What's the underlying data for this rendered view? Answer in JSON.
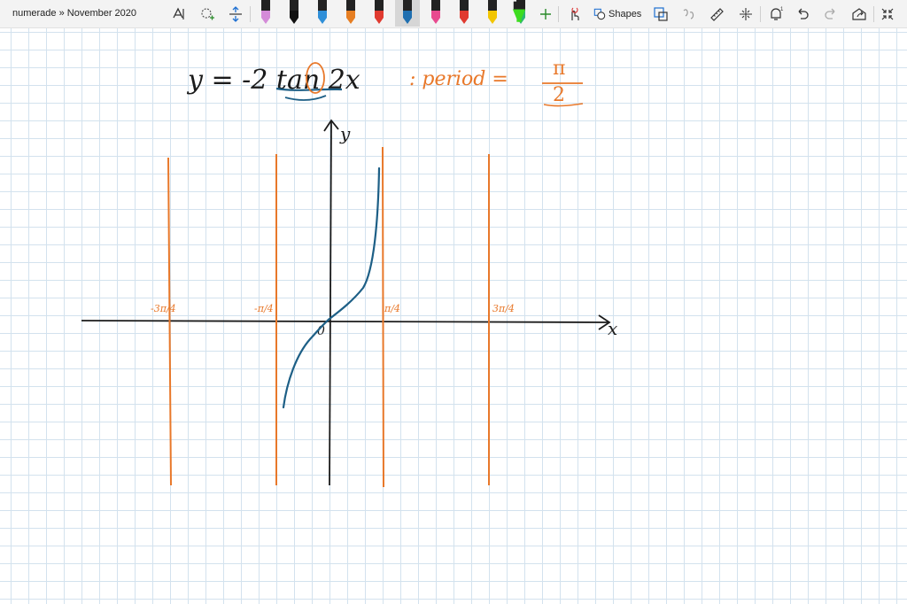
{
  "window": {
    "breadcrumb": "numerade » November 2020"
  },
  "toolbar": {
    "shapes_label": "Shapes",
    "pens": [
      {
        "color": "#d48bd8"
      },
      {
        "color": "#111111"
      },
      {
        "color": "#2f8fd8"
      },
      {
        "color": "#e67e22"
      },
      {
        "color": "#e03a2f"
      },
      {
        "color": "#1f6fb0"
      },
      {
        "color": "#e84a8f"
      },
      {
        "color": "#e03a2f"
      },
      {
        "color": "#f2c500"
      },
      {
        "color": "#2eb872"
      },
      {
        "color": "#3ddc1f"
      }
    ],
    "selected_pen": 5
  },
  "notes": {
    "equation": "y = -2 tan 2x",
    "period_label": ": period =",
    "period_value_num": "π",
    "period_value_den": "2",
    "y_axis_label": "y",
    "x_axis_label": "x",
    "origin_label": "0",
    "asymptote_labels": [
      "-3π/4",
      "-π/4",
      "π/4",
      "3π/4"
    ],
    "ink_colors": {
      "dark": "#1b1b1b",
      "blue": "#1d5f86",
      "orange": "#e8782a"
    }
  }
}
